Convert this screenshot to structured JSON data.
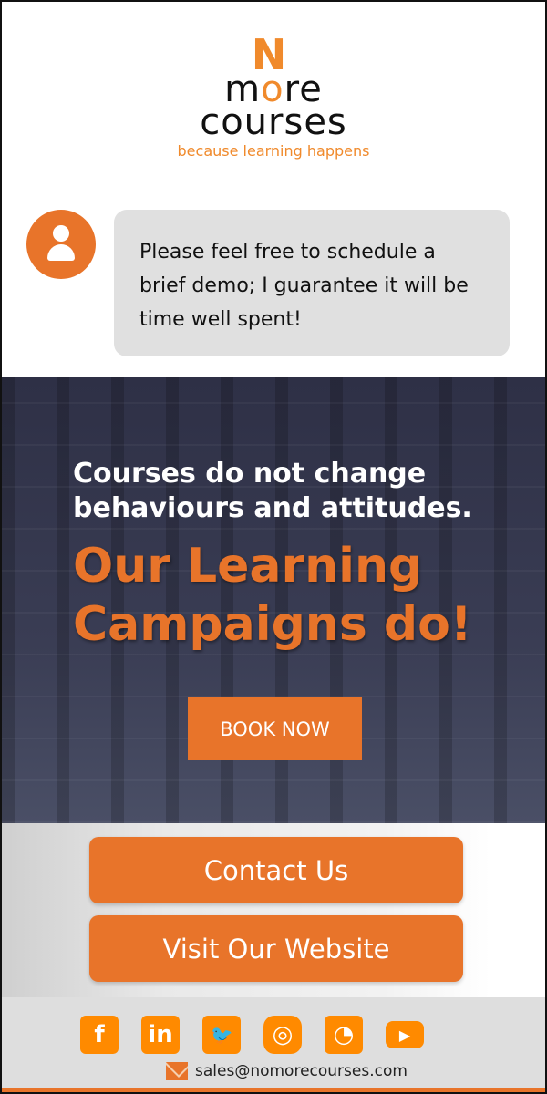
{
  "logo": {
    "n": "N",
    "word1_a": "m",
    "word1_o": "o",
    "word1_b": "re",
    "word2": "courses",
    "tagline": "because learning happens"
  },
  "message": {
    "text": "Please feel free to schedule a brief demo; I guarantee it will be time well spent!"
  },
  "hero": {
    "headline": "Courses do not change behaviours and attitudes.",
    "highlight": "Our Learning Campaigns do!",
    "cta": "BOOK NOW"
  },
  "buttons": {
    "contact": "Contact Us",
    "website": "Visit Our Website"
  },
  "footer": {
    "social": [
      {
        "icon": "facebook-icon",
        "glyph": "f"
      },
      {
        "icon": "linkedin-icon",
        "glyph": "in"
      },
      {
        "icon": "twitter-icon",
        "glyph": "🐦"
      },
      {
        "icon": "instagram-icon",
        "glyph": "◎"
      },
      {
        "icon": "rss-icon",
        "glyph": "◔"
      },
      {
        "icon": "youtube-icon",
        "glyph": "▶"
      }
    ],
    "email": "sales@nomorecourses.com"
  },
  "colors": {
    "accent": "#e8742a",
    "social": "#ff8a00",
    "bubble": "#e0e0e0"
  }
}
